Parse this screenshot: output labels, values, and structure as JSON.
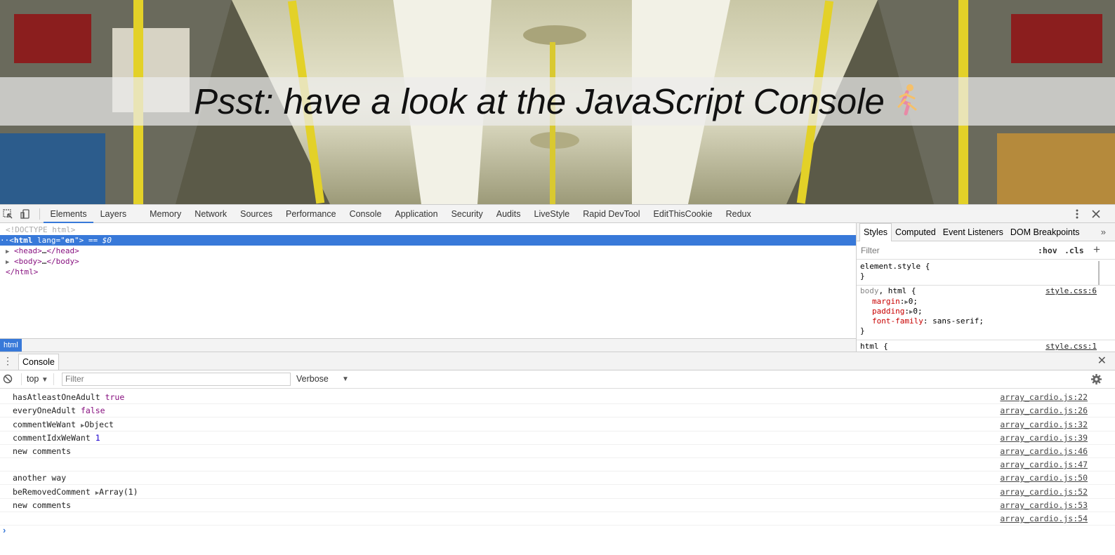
{
  "hero": {
    "title": "Psst: have a look at the JavaScript Console"
  },
  "devtools": {
    "tabs": [
      "Elements",
      "Layers",
      "Memory",
      "Network",
      "Sources",
      "Performance",
      "Console",
      "Application",
      "Security",
      "Audits",
      "LiveStyle",
      "Rapid DevTool",
      "EditThisCookie",
      "Redux"
    ],
    "active_tab": "Elements"
  },
  "elements": {
    "doctype": "<!DOCTYPE html>",
    "html_open_tag": "html",
    "html_lang_attr": "lang",
    "html_lang_val": "en",
    "selected_marker": "== $0",
    "head": "head",
    "body": "body",
    "ellipsis": "…",
    "html_close": "html",
    "breadcrumb": "html"
  },
  "styles": {
    "tabs": [
      "Styles",
      "Computed",
      "Event Listeners",
      "DOM Breakpoints"
    ],
    "more": "»",
    "filter_placeholder": "Filter",
    "hov": ":hov",
    "cls": ".cls",
    "plus": "+",
    "element_style": "element.style {",
    "close_brace": "}",
    "rule1": {
      "selector_a": "body",
      "selector_sep": ", ",
      "selector_b": "html",
      "open": " {",
      "source": "style.css:6",
      "props": [
        {
          "name": "margin",
          "value": "0;"
        },
        {
          "name": "padding",
          "value": "0;"
        },
        {
          "name": "font-family",
          "value": "sans-serif;"
        }
      ]
    },
    "rule2": {
      "selector": "html {",
      "source": "style.css:1"
    }
  },
  "drawer": {
    "tab": "Console",
    "context": "top",
    "filter_placeholder": "Filter",
    "levels": "Verbose"
  },
  "console": {
    "logs": [
      {
        "text": "hasAtleastOneAdult",
        "value": "true",
        "kind": "bool",
        "source": "array_cardio.js:22"
      },
      {
        "text": "everyOneAdult",
        "value": "false",
        "kind": "bool",
        "source": "array_cardio.js:26"
      },
      {
        "text": "commentWeWant",
        "value": "Object",
        "kind": "object",
        "source": "array_cardio.js:32"
      },
      {
        "text": "commentIdxWeWant",
        "value": "1",
        "kind": "num",
        "source": "array_cardio.js:39"
      },
      {
        "text": "new comments",
        "value": "",
        "kind": "none",
        "source": "array_cardio.js:46"
      },
      {
        "text": "",
        "value": "",
        "kind": "none",
        "source": "array_cardio.js:47"
      },
      {
        "text": "another way",
        "value": "",
        "kind": "none",
        "source": "array_cardio.js:50"
      },
      {
        "text": "beRemovedComment",
        "value": "Array(1)",
        "kind": "object",
        "source": "array_cardio.js:52"
      },
      {
        "text": "new comments",
        "value": "",
        "kind": "none",
        "source": "array_cardio.js:53"
      },
      {
        "text": "",
        "value": "",
        "kind": "none",
        "source": "array_cardio.js:54"
      }
    ],
    "prompt": "›"
  }
}
